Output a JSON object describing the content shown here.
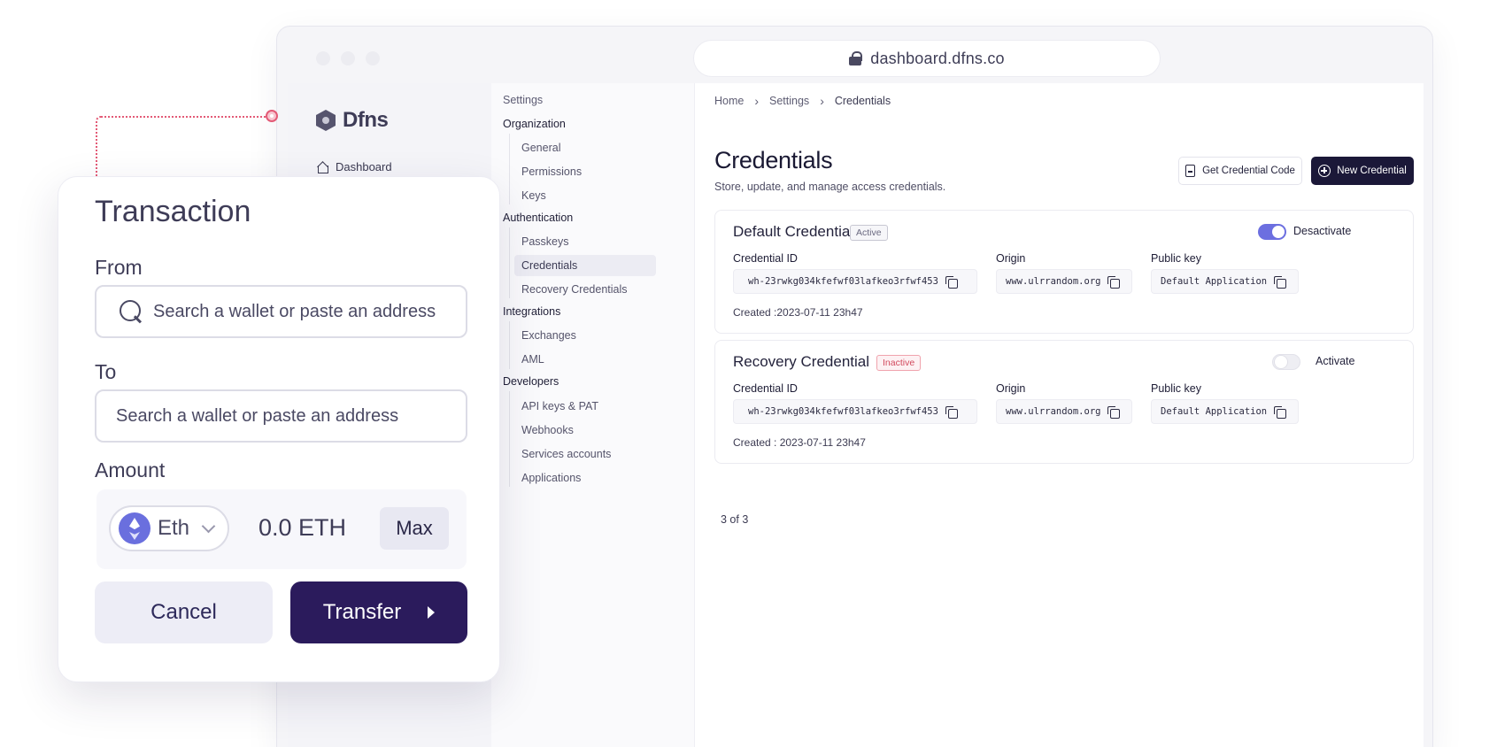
{
  "browser": {
    "url": "dashboard.dfns.co"
  },
  "sidebar": {
    "brand": "Dfns",
    "items": [
      {
        "label": "Dashboard",
        "icon": "home-icon"
      }
    ]
  },
  "settings_nav": {
    "heading": "Settings",
    "groups": [
      {
        "label": "Organization",
        "items": [
          "General",
          "Permissions",
          "Keys"
        ]
      },
      {
        "label": "Authentication",
        "items": [
          "Passkeys",
          "Credentials",
          "Recovery Credentials"
        ]
      },
      {
        "label": "Integrations",
        "items": [
          "Exchanges",
          "AML"
        ]
      },
      {
        "label": "Developers",
        "items": [
          "API keys & PAT",
          "Webhooks",
          "Services accounts",
          "Applications"
        ]
      }
    ],
    "active_item": "Credentials"
  },
  "main": {
    "breadcrumb": [
      "Home",
      "Settings",
      "Credentials"
    ],
    "title": "Credentials",
    "subtitle": "Store, update, and manage access credentials.",
    "get_code_label": "Get Credential Code",
    "new_credential_label": "New Credential",
    "field_labels": {
      "credential_id": "Credential ID",
      "origin": "Origin",
      "public_key": "Public key"
    },
    "credentials": [
      {
        "name": "Default Credential",
        "status": "Active",
        "toggle_label": "Desactivate",
        "toggle_on": true,
        "credential_id": "wh-23rwkg034kfefwf03lafkeo3rfwf453",
        "origin": "www.ulrrandom.org",
        "public_key": "Default Application",
        "created": "Created :2023-07-11 23h47"
      },
      {
        "name": "Recovery Credential",
        "status": "Inactive",
        "toggle_label": "Activate",
        "toggle_on": false,
        "credential_id": "wh-23rwkg034kfefwf03lafkeo3rfwf453",
        "origin": "www.ulrrandom.org",
        "public_key": "Default Application",
        "created": "Created : 2023-07-11 23h47"
      }
    ],
    "pagination": "3 of 3"
  },
  "transaction": {
    "title": "Transaction",
    "from_label": "From",
    "from_placeholder": "Search a wallet or paste an address",
    "to_label": "To",
    "to_placeholder": "Search a wallet or paste an address",
    "amount_label": "Amount",
    "token": "Eth",
    "amount": "0.0 ETH",
    "max_label": "Max",
    "cancel_label": "Cancel",
    "transfer_label": "Transfer"
  },
  "colors": {
    "accent": "#6c6fe0",
    "dark_button": "#1b1838",
    "transfer_button": "#2b1b5c",
    "connector": "#e35a76",
    "inactive_badge": "#d24a5e"
  }
}
